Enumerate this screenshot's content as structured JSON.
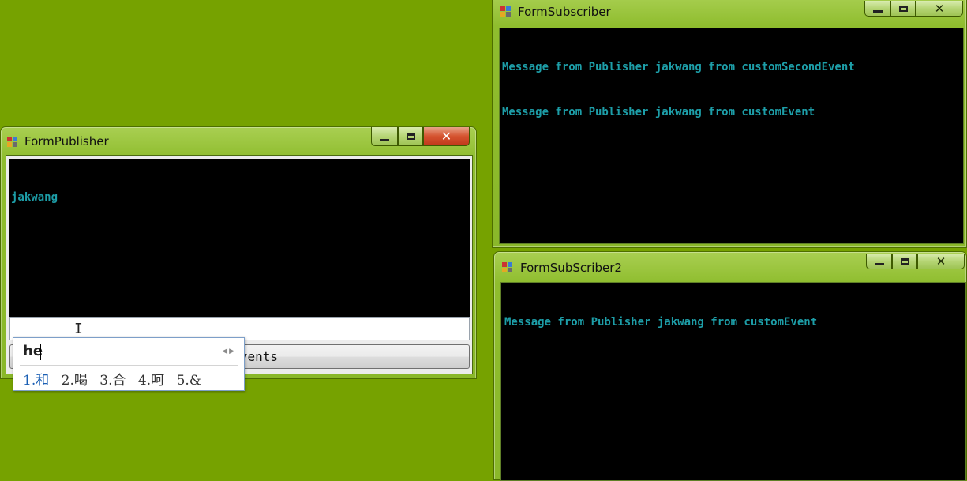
{
  "publisher": {
    "title": "FormPublisher",
    "console_lines": [
      "jakwang"
    ],
    "textbox_value": "",
    "button_label": "m Events"
  },
  "subscriber1": {
    "title": "FormSubscriber",
    "console_lines": [
      "Message from Publisher jakwang from customSecondEvent",
      "Message from Publisher jakwang from customEvent"
    ]
  },
  "subscriber2": {
    "title": "FormSubScriber2",
    "console_lines": [
      "Message from Publisher jakwang from customEvent"
    ]
  },
  "ime": {
    "input": "he",
    "candidates": [
      "1.和",
      "2.喝",
      "3.合",
      "4.呵",
      "5.&"
    ],
    "selected_index": 0
  },
  "window_controls": {
    "minimize": "minimize-icon",
    "maximize": "maximize-icon",
    "close": "close-icon"
  },
  "colors": {
    "desktop": "#76a200",
    "console_text": "#1d9ea8",
    "close_button": "#d5532f"
  }
}
